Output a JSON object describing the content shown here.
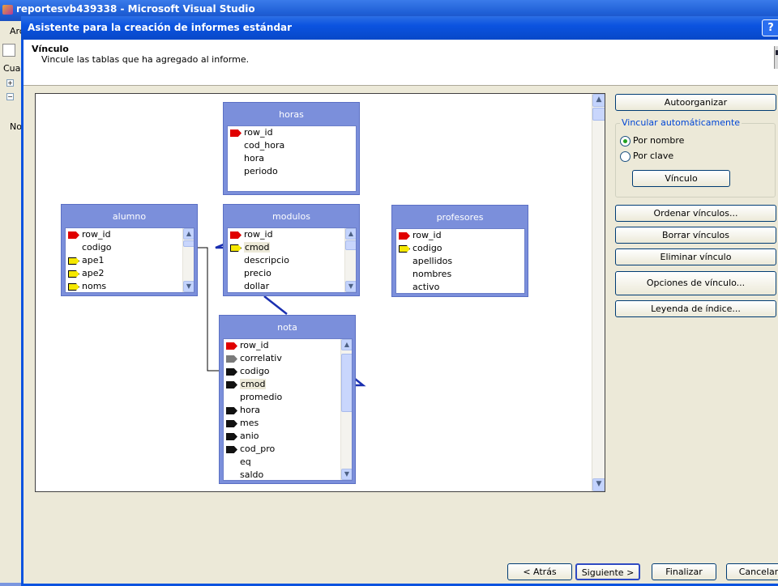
{
  "vs_window": {
    "title": "reportesvb439338 - Microsoft Visual Studio",
    "left_fragments": [
      "Arc",
      "Cuac",
      "No"
    ]
  },
  "dialog": {
    "title": "Asistente para la creación de informes estándar",
    "help": "?",
    "header_title": "Vínculo",
    "header_subtitle": "Vincule las tablas que ha agregado al informe."
  },
  "tables": {
    "horas": {
      "title": "horas",
      "fields": [
        {
          "name": "row_id",
          "key": "red"
        },
        {
          "name": "cod_hora",
          "key": ""
        },
        {
          "name": "hora",
          "key": ""
        },
        {
          "name": "periodo",
          "key": ""
        }
      ]
    },
    "alumno": {
      "title": "alumno",
      "fields": [
        {
          "name": "row_id",
          "key": "red"
        },
        {
          "name": "codigo",
          "key": ""
        },
        {
          "name": "ape1",
          "key": "yellow"
        },
        {
          "name": "ape2",
          "key": "yellow"
        },
        {
          "name": "noms",
          "key": "yellow"
        }
      ]
    },
    "modulos": {
      "title": "modulos",
      "fields": [
        {
          "name": "row_id",
          "key": "red"
        },
        {
          "name": "cmod",
          "key": "yellow"
        },
        {
          "name": "descripcio",
          "key": ""
        },
        {
          "name": "precio",
          "key": ""
        },
        {
          "name": "dollar",
          "key": ""
        }
      ]
    },
    "profesores": {
      "title": "profesores",
      "fields": [
        {
          "name": "row_id",
          "key": "red"
        },
        {
          "name": "codigo",
          "key": "yellow"
        },
        {
          "name": "apellidos",
          "key": ""
        },
        {
          "name": "nombres",
          "key": ""
        },
        {
          "name": "activo",
          "key": ""
        }
      ]
    },
    "nota": {
      "title": "nota",
      "fields": [
        {
          "name": "row_id",
          "key": "red"
        },
        {
          "name": "correlativ",
          "key": "gray"
        },
        {
          "name": "codigo",
          "key": "black"
        },
        {
          "name": "cmod",
          "key": "black"
        },
        {
          "name": "promedio",
          "key": ""
        },
        {
          "name": "hora",
          "key": "black"
        },
        {
          "name": "mes",
          "key": "black"
        },
        {
          "name": "anio",
          "key": "black"
        },
        {
          "name": "cod_pro",
          "key": "black"
        },
        {
          "name": "eq",
          "key": ""
        },
        {
          "name": "saldo",
          "key": ""
        }
      ]
    }
  },
  "side": {
    "autoorganizar": "Autoorganizar",
    "group_title": "Vincular automáticamente",
    "radio_nombre": "Por nombre",
    "radio_clave": "Por clave",
    "selected_radio": "Por nombre",
    "vinculo": "Vínculo",
    "ordenar": "Ordenar vínculos...",
    "borrar": "Borrar vínculos",
    "eliminar": "Eliminar vínculo",
    "opciones": "Opciones de vínculo...",
    "leyenda": "Leyenda de índice..."
  },
  "footer": {
    "atras": "< Atrás",
    "siguiente": "Siguiente >",
    "finalizar": "Finalizar",
    "cancelar": "Cancelar"
  },
  "colors": {
    "key_red": "#e00000",
    "key_yellow": "#f5e800",
    "key_black": "#111111",
    "key_gray": "#7a7a7a",
    "table_header": "#7b8fdb",
    "link_line": "#1a2fb0"
  }
}
